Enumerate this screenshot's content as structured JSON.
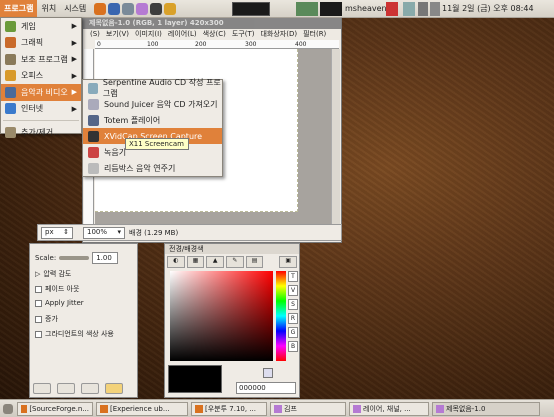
{
  "top_panel": {
    "menus": [
      "프로그램",
      "위치",
      "시스템"
    ],
    "user": "msheaven",
    "clock": "11월 2일 (금) 오후 08:44"
  },
  "image_window": {
    "title": "제목없음-1.0 (RGB, 1 layer) 420x300",
    "menubar": [
      "(S)",
      "보기(V)",
      "이미지(I)",
      "레이어(L)",
      "색상(C)",
      "도구(T)",
      "대화상자(D)",
      "필터(R)"
    ],
    "ruler_labels": [
      "0",
      "100",
      "200",
      "300",
      "400"
    ],
    "status": {
      "unit": "px",
      "zoom": "100%",
      "info": "배경 (1.29 MB)"
    }
  },
  "main_menu": {
    "items": [
      {
        "label": "게임",
        "icon": "game-icon",
        "color": "#6a9a3a"
      },
      {
        "label": "그래픽",
        "icon": "graphics-icon",
        "color": "#c96a2a"
      },
      {
        "label": "보조 프로그램",
        "icon": "accessories-icon",
        "color": "#8a7a5a"
      },
      {
        "label": "오피스",
        "icon": "office-icon",
        "color": "#d89a2a"
      },
      {
        "label": "음악과 비디오",
        "icon": "multimedia-icon",
        "color": "#4a6a9a"
      },
      {
        "label": "인터넷",
        "icon": "internet-icon",
        "color": "#3a7acc"
      }
    ],
    "extra": "추가/제거..."
  },
  "sub_menu": {
    "items": [
      {
        "label": "Serpentine Audio CD 작성 프로그램",
        "icon": "audio-cd-icon"
      },
      {
        "label": "Sound Juicer 음악 CD 가져오기",
        "icon": "cd-ripper-icon"
      },
      {
        "label": "Totem 플레이어",
        "icon": "totem-player-icon"
      },
      {
        "label": "XVidCap Screen Capture",
        "icon": "screen-capture-icon"
      },
      {
        "label": "녹음기",
        "icon": "recorder-icon"
      },
      {
        "label": "리듬박스 음악 연주기",
        "icon": "rhythmbox-icon"
      }
    ],
    "tooltip": "X11 Screencam"
  },
  "tool_options": {
    "scale_label": "Scale:",
    "scale_value": "1.00",
    "pressure": "압력 감도",
    "options": [
      "페이드 아웃",
      "Apply Jitter",
      "증가",
      "그라디언트의 색상 사용"
    ]
  },
  "color_dialog": {
    "title": "전경/배경색",
    "side_labels": [
      "T",
      "V",
      "S",
      "R",
      "G",
      "B"
    ],
    "hex": "000000",
    "fg_color": "#000000"
  },
  "taskbar": {
    "tasks": [
      "[SourceForge.n...",
      "[Experience ub...",
      "[우분투 7.10, ...",
      "김프",
      "레이어, 채널, ...",
      "제목없음-1.0"
    ]
  }
}
